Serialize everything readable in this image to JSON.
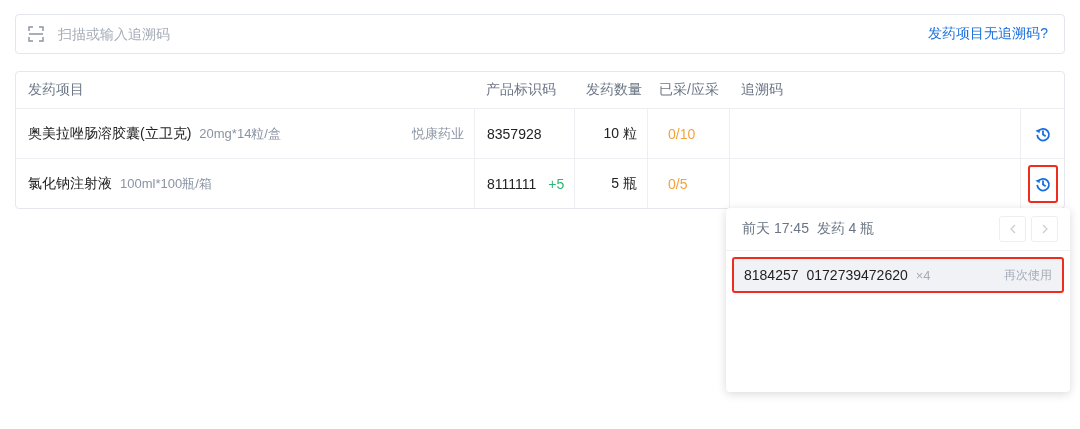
{
  "search": {
    "placeholder": "扫描或输入追溯码",
    "link": "发药项目无追溯码?"
  },
  "table": {
    "columns": [
      "发药项目",
      "产品标识码",
      "发药数量",
      "已采/应采",
      "追溯码"
    ],
    "rows": [
      {
        "name": "奥美拉唑肠溶胶囊(立卫克)",
        "spec": "20mg*14粒/盒",
        "maker": "悦康药业",
        "code": "8357928",
        "qty": "10 粒",
        "ratio": "0/10",
        "history_highlighted": false
      },
      {
        "name": "氯化钠注射液",
        "spec": "100ml*100瓶/箱",
        "code": "8111111",
        "extra": "+5",
        "qty": "5 瓶",
        "ratio": "0/5",
        "history_highlighted": true
      }
    ]
  },
  "popover": {
    "title": "前天 17:45  发药 4 瓶",
    "prev": {
      "disabled": true
    },
    "next": {
      "disabled": true
    },
    "entries": [
      {
        "code_1": "8184257",
        "code_2": "0172739472620",
        "count": "×4",
        "action": "再次使用",
        "highlighted": true
      }
    ]
  }
}
